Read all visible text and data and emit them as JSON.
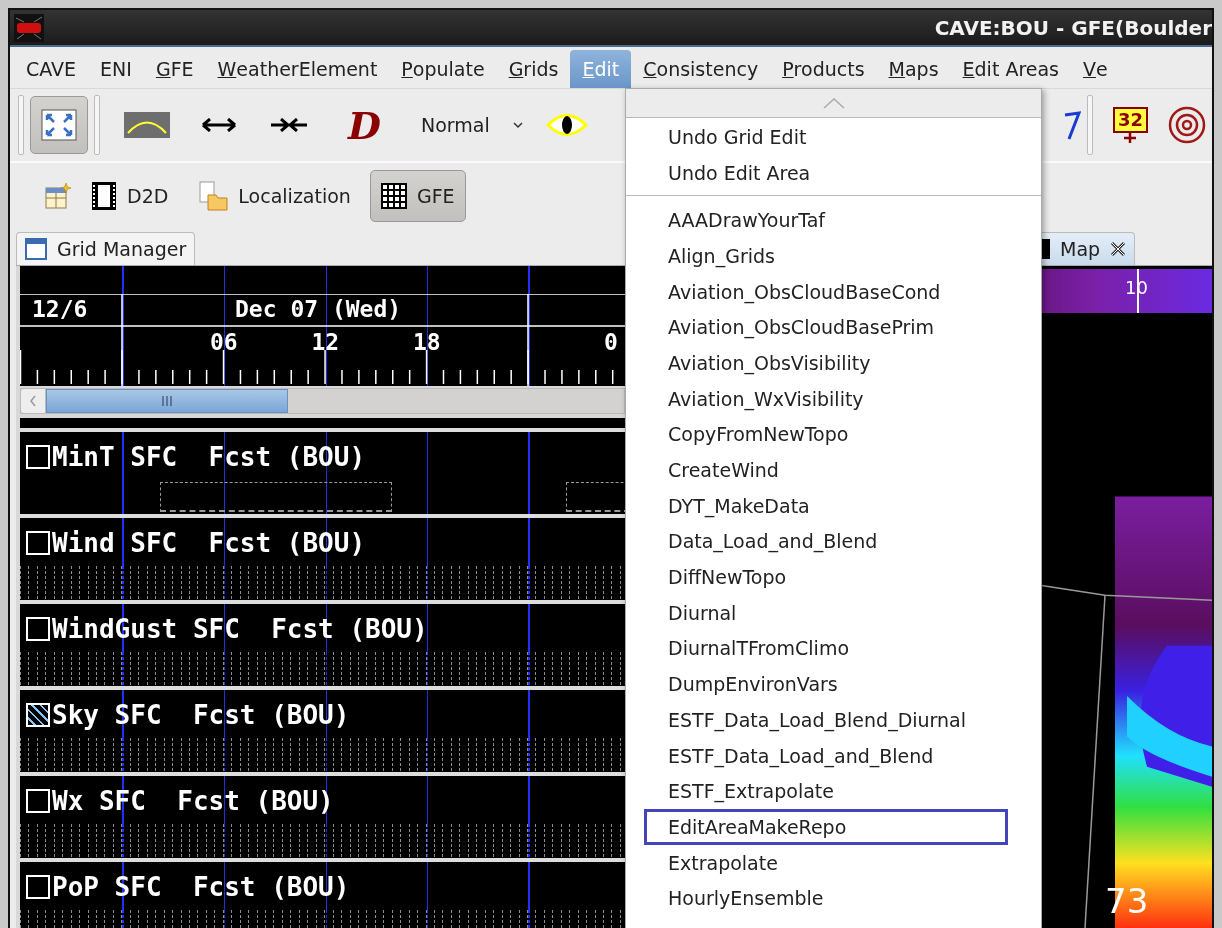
{
  "window": {
    "title": "CAVE:BOU - GFE(Boulder"
  },
  "menubar": [
    {
      "label": "CAVE",
      "underlined": false,
      "selected": false
    },
    {
      "label": "ENI",
      "underlined": false,
      "selected": false
    },
    {
      "label": "GFE",
      "underlined": true,
      "selected": false
    },
    {
      "label": "WeatherElement",
      "underlined": true,
      "selected": false
    },
    {
      "label": "Populate",
      "underlined": true,
      "selected": false
    },
    {
      "label": "Grids",
      "underlined": true,
      "selected": false
    },
    {
      "label": "Edit",
      "underlined": true,
      "selected": true
    },
    {
      "label": "Consistency",
      "underlined": true,
      "selected": false
    },
    {
      "label": "Products",
      "underlined": true,
      "selected": false
    },
    {
      "label": "Maps",
      "underlined": true,
      "selected": false
    },
    {
      "label": "Edit Areas",
      "underlined": true,
      "selected": false
    },
    {
      "label": "Ve",
      "underlined": true,
      "selected": false
    }
  ],
  "toolbar": {
    "fit_button": {
      "pressed": true
    },
    "tool_letter": "D",
    "mode_select": {
      "value": "Normal"
    },
    "sample_badge": "32"
  },
  "perspectives": [
    {
      "label": "D2D",
      "selected": false
    },
    {
      "label": "Localization",
      "selected": false
    },
    {
      "label": "GFE",
      "selected": true
    }
  ],
  "grid_manager": {
    "tab": "Grid Manager",
    "timeline": {
      "date_left": "12/6",
      "date_main": "Dec 07 (Wed)",
      "hours": [
        "06",
        "12",
        "18",
        "0"
      ]
    },
    "rows": [
      {
        "name": "MinT SFC  Fcst (BOU)",
        "checked": false,
        "kind": "blocks"
      },
      {
        "name": "Wind SFC  Fcst (BOU)",
        "checked": false,
        "kind": "hourly"
      },
      {
        "name": "WindGust SFC  Fcst (BOU)",
        "checked": false,
        "kind": "hourly"
      },
      {
        "name": "Sky SFC  Fcst (BOU)",
        "checked": true,
        "kind": "hourly"
      },
      {
        "name": "Wx SFC  Fcst (BOU)",
        "checked": false,
        "kind": "hourly"
      },
      {
        "name": "PoP SFC  Fcst (BOU)",
        "checked": false,
        "kind": "hourly"
      }
    ]
  },
  "map_panel": {
    "tab": "Map",
    "colorbar_label": "10",
    "value_label": "73"
  },
  "edit_menu": {
    "groups": [
      {
        "items": [
          {
            "label": "Undo Grid Edit",
            "selected": false
          },
          {
            "label": "Undo Edit Area",
            "selected": false
          }
        ]
      },
      {
        "items": [
          {
            "label": "AAADrawYourTaf",
            "selected": false
          },
          {
            "label": "Align_Grids",
            "selected": false
          },
          {
            "label": "Aviation_ObsCloudBaseCond",
            "selected": false
          },
          {
            "label": "Aviation_ObsCloudBasePrim",
            "selected": false
          },
          {
            "label": "Aviation_ObsVisibility",
            "selected": false
          },
          {
            "label": "Aviation_WxVisibility",
            "selected": false
          },
          {
            "label": "CopyFromNewTopo",
            "selected": false
          },
          {
            "label": "CreateWind",
            "selected": false
          },
          {
            "label": "DYT_MakeData",
            "selected": false
          },
          {
            "label": "Data_Load_and_Blend",
            "selected": false
          },
          {
            "label": "DiffNewTopo",
            "selected": false
          },
          {
            "label": "Diurnal",
            "selected": false
          },
          {
            "label": "DiurnalTFromClimo",
            "selected": false
          },
          {
            "label": "DumpEnvironVars",
            "selected": false
          },
          {
            "label": "ESTF_Data_Load_Blend_Diurnal",
            "selected": false
          },
          {
            "label": "ESTF_Data_Load_and_Blend",
            "selected": false
          },
          {
            "label": "ESTF_Extrapolate",
            "selected": false
          },
          {
            "label": "EditAreaMakeRepo",
            "selected": true
          },
          {
            "label": "Extrapolate",
            "selected": false
          },
          {
            "label": "HourlyEnsemble",
            "selected": false
          }
        ]
      }
    ]
  }
}
